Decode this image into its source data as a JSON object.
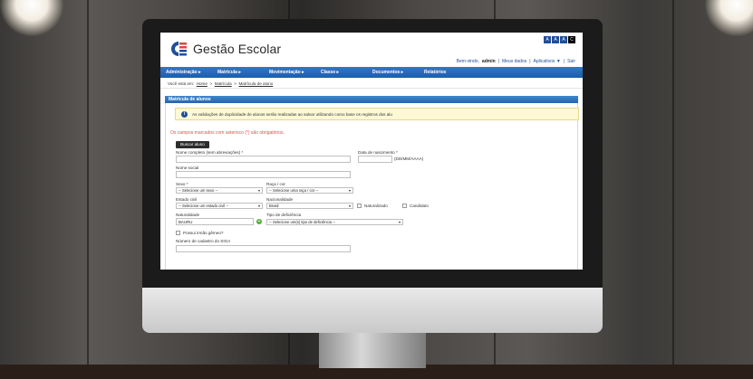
{
  "app": {
    "brand": "Gestão Escolar",
    "accessibility": [
      "A",
      "A",
      "A",
      "C"
    ]
  },
  "user_bar": {
    "welcome": "Bem-vindo,",
    "user": "admin",
    "links": [
      "Meus dados",
      "Aplicativos ▼",
      "Sair"
    ]
  },
  "nav": {
    "items": [
      "Administração",
      "Matrícula",
      "Movimentação",
      "Classe",
      "Documentos",
      "Relatórios"
    ]
  },
  "breadcrumb": {
    "prefix": "Você está em:",
    "items": [
      "Home",
      "Matrícula",
      "Matrícula de aluno"
    ],
    "separator": ">"
  },
  "panel": {
    "title": "Matrícula de alunos",
    "alert": "As validações de duplicidade de alunos serão realizadas ao salvar utilizando como base os registros dos alu",
    "required_note": "Os campos marcados com asterisco (*) são obrigatórios.",
    "search_button": "Buscar aluno"
  },
  "form": {
    "full_name_label": "Nome completo (sem abreviações) *",
    "full_name_value": "",
    "birth_label": "Data de nascimento *",
    "birth_hint": "(DD/MM/AAAA)",
    "social_name_label": "Nome social",
    "sex_label": "Sexo *",
    "sex_value": "-- Selecione um sexo --",
    "race_label": "Raça / cor",
    "race_value": "-- Selecione uma raça / cor --",
    "civil_label": "Estado civil",
    "civil_value": "-- Selecione um estado civil --",
    "nationality_label": "Nacionalidade",
    "nationality_value": "Brasil",
    "naturalized_label": "Naturalizado",
    "candidate_label": "Candidato",
    "birthplace_label": "Naturalidade",
    "birthplace_value": "BAURU",
    "disability_label": "Tipo de deficiência",
    "disability_value": "-- Selecione um(s) tipo de deficiência --",
    "twin_label": "Possui irmão gêmeo?",
    "siga_label": "Número de cadastro do SIGA"
  },
  "colors": {
    "nav": "#1d5ea8",
    "alert_bg": "#fdf8d6",
    "required_text": "#e05050"
  }
}
